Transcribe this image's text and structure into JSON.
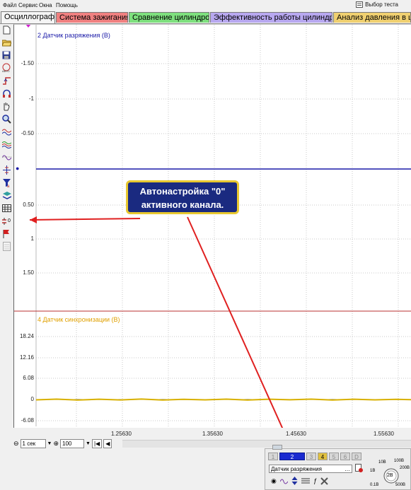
{
  "menu": {
    "items": [
      "Файл",
      "Сервис",
      "Окна",
      "Помощь"
    ],
    "test_select": "Выбор теста"
  },
  "tabs": [
    {
      "label": "Осциллограф",
      "color": "#f5f5f5"
    },
    {
      "label": "Система зажигания",
      "color": "#f08080"
    },
    {
      "label": "Сравнение цилиндров",
      "color": "#7ee07e"
    },
    {
      "label": "Эффективность работы цилиндров",
      "color": "#b8a8f0"
    },
    {
      "label": "Анализ давления в цилиндре",
      "color": "#f0d070"
    }
  ],
  "channel2": {
    "label": "2 Датчик разряжения (В)",
    "color": "#1a1aa8",
    "yticks": [
      "-1.50",
      "-1",
      "-0.50",
      "0.50",
      "1",
      "1.50"
    ],
    "zero_marker": "●"
  },
  "channel4": {
    "label": "4 Датчик синхронизации (В)",
    "color": "#e0a000",
    "yticks": [
      "18.24",
      "12.16",
      "6.08",
      "0",
      "-6.08"
    ]
  },
  "xaxis": {
    "ticks": [
      "1.25630",
      "1.35630",
      "1.45630",
      "1.55630"
    ]
  },
  "callout": {
    "text_line1": "Автонастройка \"0\"",
    "text_line2": "активного канала."
  },
  "statusbar": {
    "timebase": "1 сек",
    "zoom": "100"
  },
  "channel_panel": {
    "buttons": [
      "1",
      "2",
      "3",
      "4",
      "5",
      "6",
      "D"
    ],
    "active": "2",
    "sensor": "Датчик разряжения",
    "knob_value": "2В",
    "knob_labels": [
      "10В",
      "100В",
      "200В",
      "500В",
      "1В",
      "0.1В"
    ]
  },
  "toolbar_zero_label": "0"
}
